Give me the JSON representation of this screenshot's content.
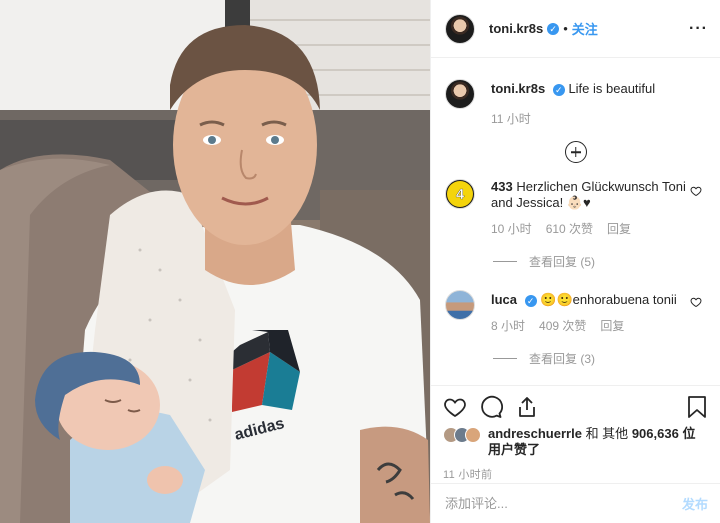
{
  "photo": {
    "shirt_brand": "adidas"
  },
  "header": {
    "username": "toni.kr8s",
    "follow_label": "关注",
    "more_label": "···",
    "verified_icon": "verified-badge-icon",
    "separator": "•"
  },
  "caption": {
    "username": "toni.kr8s",
    "text": "Life is beautiful",
    "time": "11 小时"
  },
  "load_more_icon": "plus-circle-icon",
  "comments": [
    {
      "username": "433",
      "avatar_text": "4",
      "text": "Herzlichen Glückwunsch Toni and Jessica! 👶🏻♥",
      "time": "10 小时",
      "likes": "610 次赞",
      "reply": "回复",
      "view_replies": "查看回复 (5)"
    },
    {
      "username": "luca",
      "text": "🙂🙂enhorabuena tonii",
      "time": "8 小时",
      "likes": "409 次赞",
      "reply": "回复",
      "view_replies": "查看回复 (3)"
    }
  ],
  "actions": {
    "like_icon": "heart-icon",
    "comment_icon": "comment-icon",
    "share_icon": "share-icon",
    "save_icon": "bookmark-icon"
  },
  "likes": {
    "first_user": "andreschuerrle",
    "and_text": "和 其他",
    "count": "906,636",
    "suffix": "位用户赞了"
  },
  "timestamp": "11 小时前",
  "composer": {
    "placeholder": "添加评论...",
    "post_label": "发布"
  }
}
